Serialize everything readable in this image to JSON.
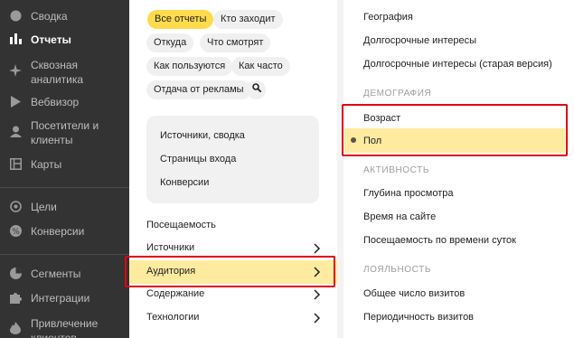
{
  "sidebar": {
    "items": [
      {
        "label": "Сводка",
        "icon": "home-icon"
      },
      {
        "label": "Отчеты",
        "icon": "bar-chart-icon"
      },
      {
        "label": "Сквозная аналитика",
        "icon": "star-icon"
      },
      {
        "label": "Вебвизор",
        "icon": "play-icon"
      },
      {
        "label": "Посетители и клиенты",
        "icon": "person-icon"
      },
      {
        "label": "Карты",
        "icon": "map-icon"
      },
      {
        "label": "Цели",
        "icon": "target-icon"
      },
      {
        "label": "Конверсии",
        "icon": "percent-icon"
      },
      {
        "label": "Сегменты",
        "icon": "segments-icon"
      },
      {
        "label": "Интеграции",
        "icon": "puzzle-icon"
      },
      {
        "label": "Привлечение клиентов",
        "icon": "flame-icon"
      }
    ],
    "active": "Отчеты"
  },
  "chips": [
    {
      "label": "Все отчеты",
      "active": true
    },
    {
      "label": "Кто заходит"
    },
    {
      "label": "Откуда"
    },
    {
      "label": "Что смотрят"
    },
    {
      "label": "Как пользуются"
    },
    {
      "label": "Как часто"
    },
    {
      "label": "Отдача от рекламы"
    }
  ],
  "favorites": [
    "Источники, сводка",
    "Страницы входа",
    "Конверсии"
  ],
  "menu": [
    {
      "label": "Посещаемость"
    },
    {
      "label": "Источники"
    },
    {
      "label": "Аудитория",
      "selected": true
    },
    {
      "label": "Содержание"
    },
    {
      "label": "Технологии"
    }
  ],
  "right_panel": {
    "top_items": [
      "География",
      "Долгосрочные интересы",
      "Долгосрочные интересы (старая версия)"
    ],
    "demography_header": "ДЕМОГРАФИЯ",
    "demography_items": [
      "Возраст",
      "Пол"
    ],
    "activity_header": "АКТИВНОСТЬ",
    "activity_items": [
      "Глубина просмотра",
      "Время на сайте",
      "Посещаемость по времени суток"
    ],
    "loyalty_header": "ЛОЯЛЬНОСТЬ",
    "loyalty_items": [
      "Общее число визитов",
      "Периодичность визитов"
    ],
    "selected": "Пол"
  },
  "colors": {
    "sidebar_bg": "#333333",
    "accent": "#ffdb4d",
    "highlight": "#ffeba0",
    "frame": "#e3000f"
  }
}
